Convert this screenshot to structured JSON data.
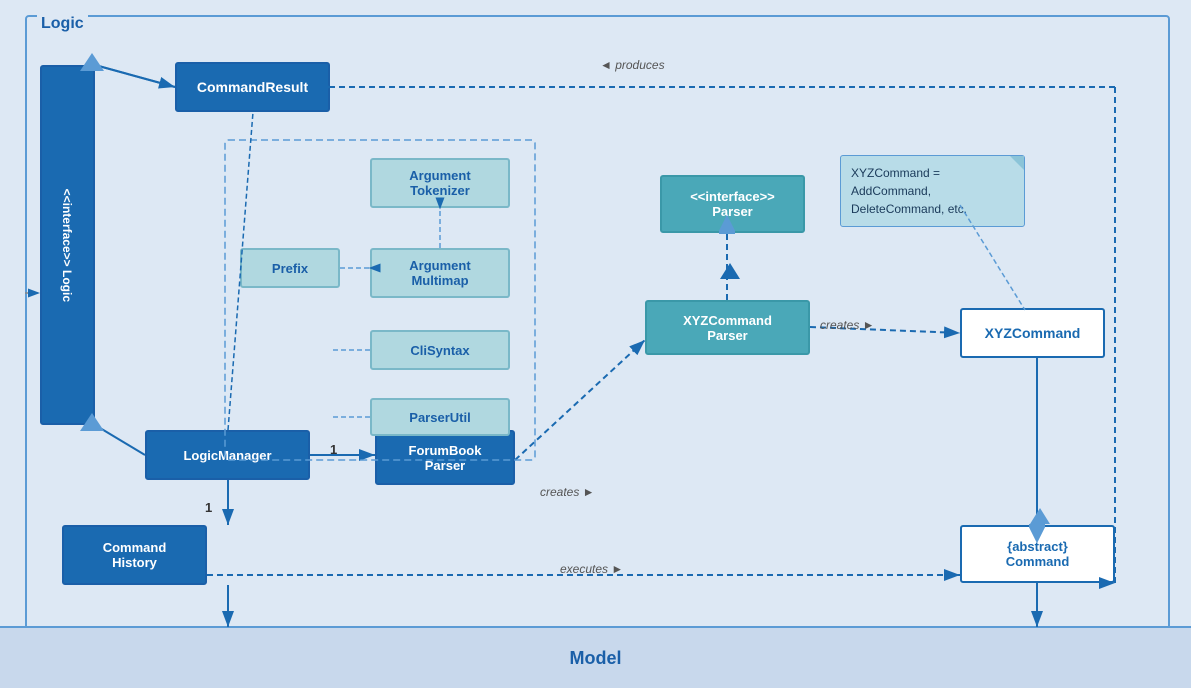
{
  "diagram": {
    "title": "Logic",
    "model_label": "Model",
    "nodes": {
      "interface_logic": "<<interface>>\nLogic",
      "command_result": "CommandResult",
      "logic_manager": "LogicManager",
      "forum_book_parser": "ForumBook\nParser",
      "argument_tokenizer": "Argument\nTokenizer",
      "argument_multimap": "Argument\nMultimap",
      "prefix": "Prefix",
      "cli_syntax": "CliSyntax",
      "parser_util": "ParserUtil",
      "parser_interface": "<<interface>>\nParser",
      "xyz_command_parser": "XYZCommand\nParser",
      "xyz_command": "XYZCommand",
      "abstract_command": "{abstract}\nCommand",
      "command_history": "Command\nHistory"
    },
    "note": "XYZCommand =\nAddCommand,\nDeleteCommand, etc.",
    "arrow_labels": {
      "produces": "◄ produces",
      "creates_parser": "creates ►",
      "creates_command": "creates ►",
      "executes": "executes ►"
    }
  }
}
